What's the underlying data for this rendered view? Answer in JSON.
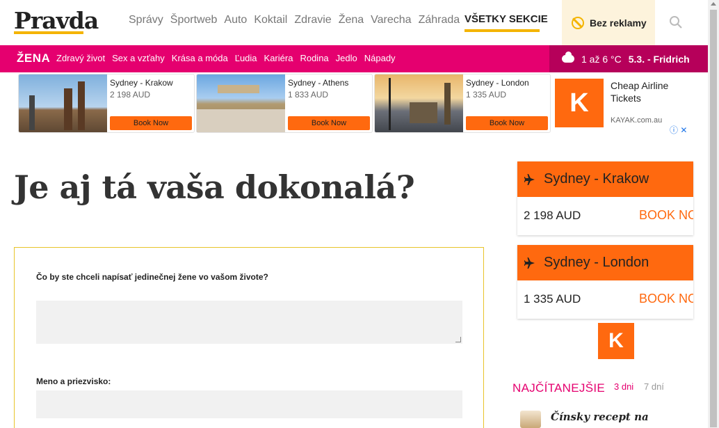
{
  "header": {
    "logo": "Pravda",
    "nav": [
      "Správy",
      "Športweb",
      "Auto",
      "Koktail",
      "Zdravie",
      "Žena",
      "Varecha",
      "Záhrada"
    ],
    "all_sections": "VŠETKY SEKCIE",
    "no_ads": "Bez reklamy",
    "search_icon": "search-icon"
  },
  "section_nav": {
    "title": "ŽENA",
    "items": [
      "Zdravý život",
      "Sex a vzťahy",
      "Krása a móda",
      "Ľudia",
      "Kariéra",
      "Rodina",
      "Jedlo",
      "Nápady"
    ]
  },
  "weather": {
    "temp": "1 až 6 °C",
    "date_name": "5.3. - Fridrich",
    "icon": "cloud-icon"
  },
  "ads": {
    "cards": [
      {
        "city": "Sydney - Krakow",
        "price": "2 198 AUD",
        "button": "Book Now"
      },
      {
        "city": "Sydney - Athens",
        "price": "1 833 AUD",
        "button": "Book Now"
      },
      {
        "city": "Sydney - London",
        "price": "1 335 AUD",
        "button": "Book Now"
      }
    ],
    "kayak_logo": "K",
    "kayak_text": "Cheap Airline Tickets",
    "kayak_domain": "KAYAK.com.au",
    "adchoices": "ⓘ ✕"
  },
  "article": {
    "title": "Je aj tá vaša dokonalá?",
    "form": {
      "question_label": "Čo by ste chceli napísať jedinečnej žene vo vašom živote?",
      "name_label": "Meno a priezvisko:"
    }
  },
  "sidebar": {
    "flights": [
      {
        "route": "Sydney - Krakow",
        "amount": "2 198 AUD",
        "book": "BOOK NOW"
      },
      {
        "route": "Sydney - London",
        "amount": "1 335 AUD",
        "book": "BOOK NOW"
      }
    ],
    "kayak_logo": "K",
    "most_read": "NAJČÍTANEJŠIE",
    "tab_3days": "3 dni",
    "tab_7days": "7 dní",
    "top_item": "Čínsky recept na"
  },
  "colors": {
    "brand_yellow": "#f4b400",
    "pink": "#e5006f",
    "kayak_orange": "#ff690f"
  }
}
